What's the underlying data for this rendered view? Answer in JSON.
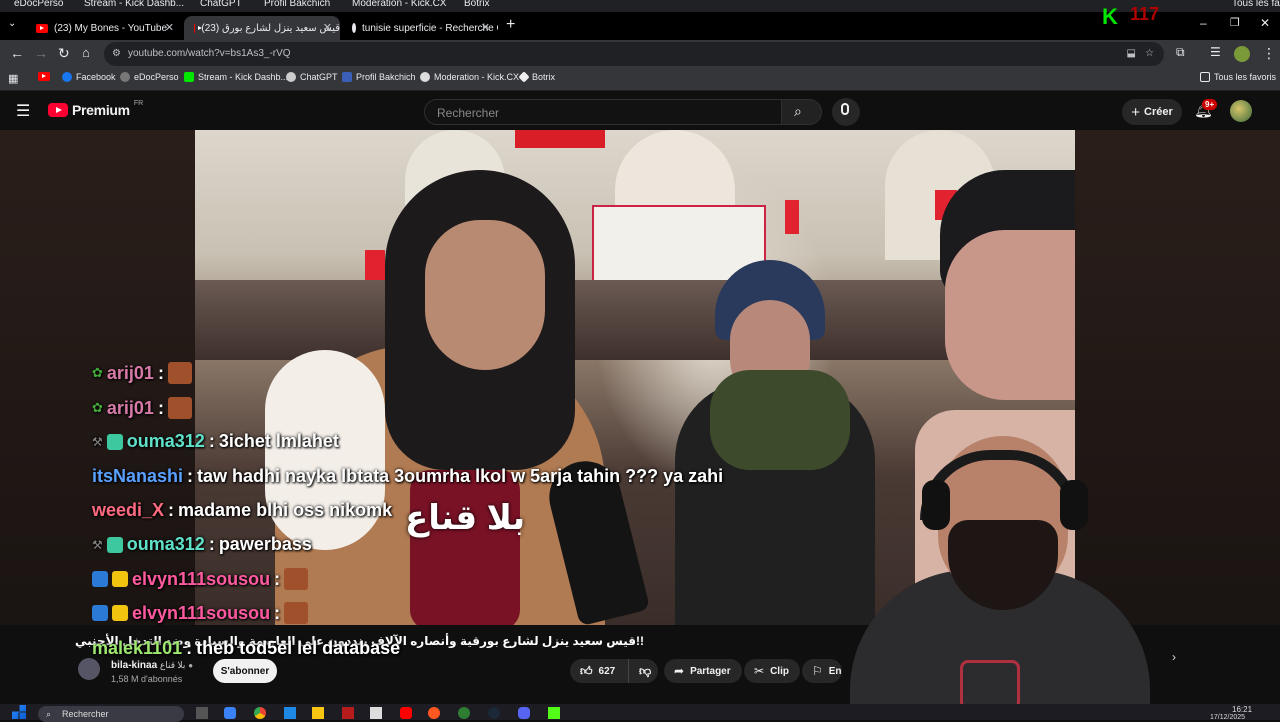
{
  "top_strip": [
    "eDocPerso",
    "Stream - Kick Dashb...",
    "ChatGPT",
    "Profil Bakchich",
    "Moderation - Kick.CX",
    "Botrix",
    "Tous les fa"
  ],
  "tabs": [
    {
      "label": "(23) My Bones - YouTube"
    },
    {
      "label": "(23) قيس سعيد ينزل لشارع بورق"
    },
    {
      "label": "tunisie superficie - Recherche G"
    }
  ],
  "kick_overlay": {
    "logo": "K",
    "count": "117"
  },
  "address": {
    "url": "youtube.com/watch?v=bs1As3_-rVQ"
  },
  "bookmarks": [
    "Facebook",
    "eDocPerso",
    "Stream - Kick Dashb...",
    "ChatGPT",
    "Profil Bakchich",
    "Moderation - Kick.CX",
    "Botrix"
  ],
  "bookmarks_all": "Tous les favoris",
  "youtube": {
    "logo": "Premium",
    "region": "FR",
    "search_placeholder": "Rechercher",
    "create_label": "Créer",
    "notifications": "9+"
  },
  "video_overlay": {
    "arabic_caption": "بلا قناع"
  },
  "chat": [
    {
      "user": "arij01",
      "color": "#d77aa8",
      "message": "",
      "emote": true
    },
    {
      "user": "arij01",
      "color": "#d77aa8",
      "message": "",
      "emote": true
    },
    {
      "user": "ouma312",
      "color": "#5fe0c8",
      "message": "3ichet lmlahet",
      "emote": false
    },
    {
      "user": "itsNanashi",
      "color": "#5aa0ff",
      "message": "taw hadhi nayka lbtata 3oumrha lkol w 5arja tahin ??? ya zahi",
      "emote": false
    },
    {
      "user": "weedi_X",
      "color": "#ff6a80",
      "message": "madame blhi oss nikomk",
      "emote": false
    },
    {
      "user": "ouma312",
      "color": "#5fe0c8",
      "message": "pawerbass",
      "emote": false
    },
    {
      "user": "elvyn111sousou",
      "color": "#ff5aa0",
      "message": "",
      "emote": true
    },
    {
      "user": "elvyn111sousou",
      "color": "#ff5aa0",
      "message": "",
      "emote": true
    },
    {
      "user": "malek1101",
      "color": "#9fe870",
      "message": "theb tod5el lel database",
      "emote": false
    }
  ],
  "video_info": {
    "title": "!!قيس سعيد ينزل لشارع بورقية وأنصاره الآلاف ينددون على العاصمة والسيادة وضد التدخل الأجنبي",
    "channel": "bila-kinaa",
    "channel_ar": "بلا قناع",
    "subscribers": "1,58 M d'abonnés",
    "subscribe_label": "S'abonner",
    "likes": "627",
    "share_label": "Partager",
    "clip_label": "Clip",
    "save_label": "Enregi"
  },
  "taskbar": {
    "search_placeholder": "Rechercher",
    "time": "16:21",
    "date": "17/12/2025"
  }
}
